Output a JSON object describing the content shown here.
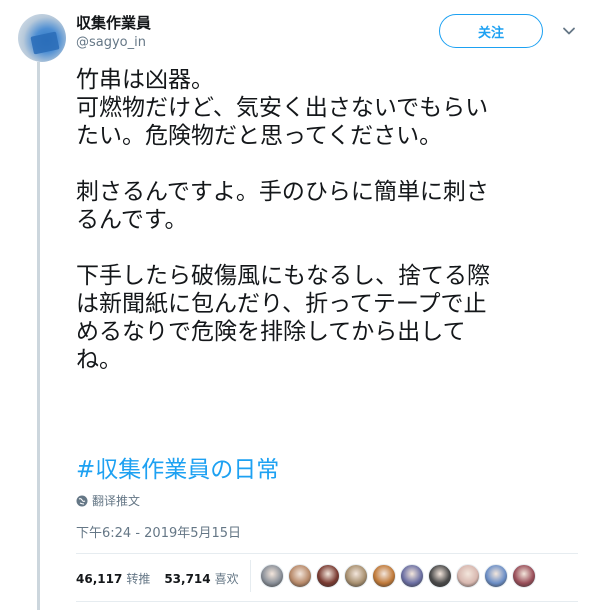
{
  "author": {
    "display_name": "収集作業員",
    "handle": "@sagyo_in"
  },
  "follow_button_label": "关注",
  "tweet_lines": [
    "竹串は凶器。",
    "可燃物だけど、気安く出さないでもらい",
    "たい。危険物だと思ってください。",
    "",
    "刺さるんですよ。手のひらに簡単に刺さ",
    "るんです。",
    "",
    "下手したら破傷風にもなるし、捨てる際",
    "は新聞紙に包んだり、折ってテープで止",
    "めるなりで危険を排除してから出して",
    "ね。"
  ],
  "hashtag": "#収集作業員の日常",
  "translate_label": "翻译推文",
  "timestamp": "下午6:24 - 2019年5月15日",
  "stats": {
    "retweets_count": "46,117",
    "retweets_label": "转推",
    "likes_count": "53,714",
    "likes_label": "喜欢"
  },
  "liker_avatar_colors": [
    "#8a9099",
    "#b88a6a",
    "#7a3b32",
    "#a89070",
    "#c07a3a",
    "#6b6fa3",
    "#4a4a4a",
    "#d8b8b0",
    "#6c8fc7",
    "#9a4f5a"
  ],
  "colors": {
    "accent": "#1da1f2",
    "text": "#14171a",
    "muted": "#657786"
  }
}
